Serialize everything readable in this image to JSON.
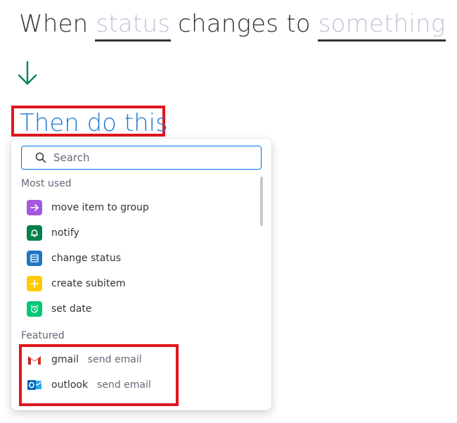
{
  "trigger": {
    "prefix": "When",
    "field_slot": "status",
    "middle": "changes to",
    "value_slot": "something"
  },
  "action": {
    "title": "Then do this"
  },
  "dropdown": {
    "search": {
      "placeholder": "Search",
      "value": ""
    },
    "most_used_label": "Most used",
    "most_used": [
      {
        "label": "move item to group",
        "icon": "arrow-right-icon",
        "color": "#a358df"
      },
      {
        "label": "notify",
        "icon": "bell-icon",
        "color": "#037f4c"
      },
      {
        "label": "change status",
        "icon": "list-icon",
        "color": "#1f76c2"
      },
      {
        "label": "create subitem",
        "icon": "plus-icon",
        "color": "#ffcb00"
      },
      {
        "label": "set date",
        "icon": "alarm-clock-icon",
        "color": "#00c875"
      }
    ],
    "featured_label": "Featured",
    "featured": [
      {
        "label": "gmail",
        "secondary": "send email",
        "icon": "gmail-icon"
      },
      {
        "label": "outlook",
        "secondary": "send email",
        "icon": "outlook-icon"
      }
    ]
  },
  "colors": {
    "accent_blue": "#1f7ad6",
    "arrow_green": "#00854d",
    "highlight_red": "#e0161e",
    "slot_text": "#c0c4d6"
  }
}
